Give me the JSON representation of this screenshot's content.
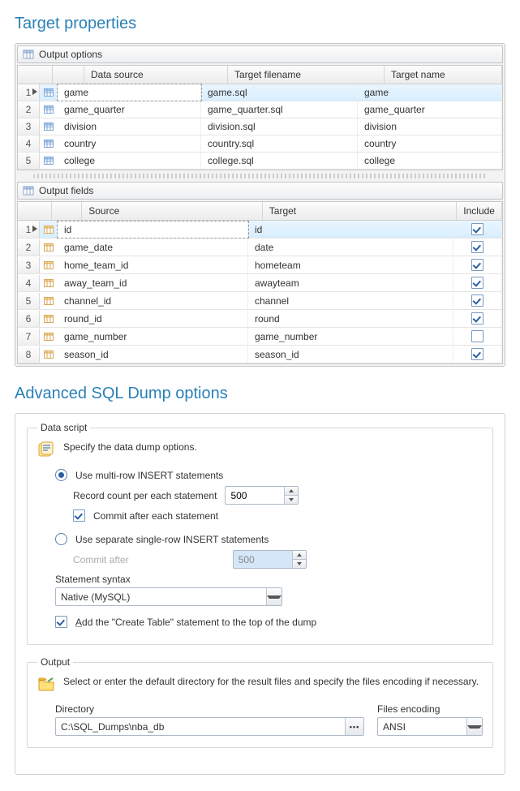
{
  "sections": {
    "target_properties": "Target properties",
    "advanced": "Advanced SQL Dump options"
  },
  "output_options": {
    "title": "Output options",
    "headers": {
      "src": "Data source",
      "tf": "Target filename",
      "tn": "Target name"
    },
    "rows": [
      {
        "src": "game",
        "tf": "game.sql",
        "tn": "game",
        "sel": true
      },
      {
        "src": "game_quarter",
        "tf": "game_quarter.sql",
        "tn": "game_quarter"
      },
      {
        "src": "division",
        "tf": "division.sql",
        "tn": "division"
      },
      {
        "src": "country",
        "tf": "country.sql",
        "tn": "country"
      },
      {
        "src": "college",
        "tf": "college.sql",
        "tn": "college"
      }
    ]
  },
  "output_fields": {
    "title": "Output fields",
    "headers": {
      "src": "Source",
      "tgt": "Target",
      "inc": "Include"
    },
    "rows": [
      {
        "src": "id",
        "tgt": "id",
        "inc": true,
        "sel": true
      },
      {
        "src": "game_date",
        "tgt": "date",
        "inc": true
      },
      {
        "src": "home_team_id",
        "tgt": "hometeam",
        "inc": true
      },
      {
        "src": "away_team_id",
        "tgt": "awayteam",
        "inc": true
      },
      {
        "src": "channel_id",
        "tgt": "channel",
        "inc": true
      },
      {
        "src": "round_id",
        "tgt": "round",
        "inc": true
      },
      {
        "src": "game_number",
        "tgt": "game_number",
        "inc": false
      },
      {
        "src": "season_id",
        "tgt": "season_id",
        "inc": true
      }
    ]
  },
  "data_script": {
    "legend": "Data script",
    "intro": "Specify the data dump options.",
    "radio1": "Use multi-row INSERT statements",
    "record_count_lbl": "Record count per each statement",
    "record_count_val": "500",
    "commit_each": "Commit after each statement",
    "radio2": "Use separate single-row INSERT statements",
    "commit_after_lbl": "Commit after",
    "commit_after_val": "500",
    "stmt_syntax_lbl": "Statement syntax",
    "stmt_syntax_val": "Native (MySQL)",
    "add_create": "Add the \"Create Table\" statement to the top of the dump"
  },
  "output": {
    "legend": "Output",
    "intro": "Select or enter the default directory for the result files and specify the files encoding if necessary.",
    "dir_lbl": "Directory",
    "dir_val": "C:\\SQL_Dumps\\nba_db",
    "enc_lbl": "Files encoding",
    "enc_val": "ANSI"
  }
}
